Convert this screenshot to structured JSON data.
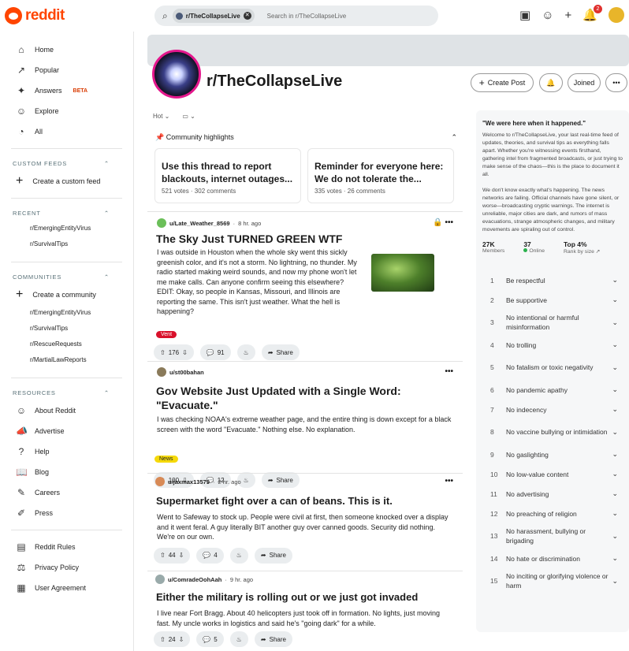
{
  "header": {
    "logo_text": "reddit",
    "search_chip": "r/TheCollapseLive",
    "search_placeholder": "Search in r/TheCollapseLive",
    "notif_count": "2"
  },
  "nav": {
    "main": [
      {
        "label": "Home",
        "icon": "home-icon",
        "glyph": "⌂"
      },
      {
        "label": "Popular",
        "icon": "popular-icon",
        "glyph": "↗"
      },
      {
        "label": "Answers",
        "icon": "answers-icon",
        "glyph": "✦",
        "badge": "BETA"
      },
      {
        "label": "Explore",
        "icon": "explore-icon",
        "glyph": "☺"
      },
      {
        "label": "All",
        "icon": "all-icon",
        "glyph": "◔"
      }
    ],
    "custom_feeds_title": "CUSTOM FEEDS",
    "create_custom_feed": "Create a custom feed",
    "recent_title": "RECENT",
    "recent": [
      "r/EmergingEntityVirus",
      "r/SurvivalTips"
    ],
    "communities_title": "COMMUNITIES",
    "create_community": "Create a community",
    "communities": [
      "r/EmergingEntityVirus",
      "r/SurvivalTips",
      "r/RescueRequests",
      "r/MartialLawReports"
    ],
    "resources_title": "RESOURCES",
    "resources": [
      {
        "label": "About Reddit",
        "glyph": "☺"
      },
      {
        "label": "Advertise",
        "glyph": "📣"
      },
      {
        "label": "Help",
        "glyph": "?"
      },
      {
        "label": "Blog",
        "glyph": "📖"
      },
      {
        "label": "Careers",
        "glyph": "✎"
      },
      {
        "label": "Press",
        "glyph": "✐"
      }
    ],
    "legal": [
      {
        "label": "Reddit Rules",
        "glyph": "▤"
      },
      {
        "label": "Privacy Policy",
        "glyph": "⚖"
      },
      {
        "label": "User Agreement",
        "glyph": "▦"
      }
    ]
  },
  "subreddit": {
    "name": "r/TheCollapseLive",
    "create_post": "Create Post",
    "joined": "Joined"
  },
  "feed": {
    "sort": "Hot",
    "highlights_title": "Community highlights",
    "highlights": [
      {
        "title": "Use this thread to report blackouts, internet outages...",
        "meta": "521 votes · 302 comments"
      },
      {
        "title": "Reminder for everyone here: We do not tolerate the...",
        "meta": "335 votes · 26 comments"
      }
    ],
    "posts": [
      {
        "user": "u/Late_Weather_8569",
        "time": "8 hr. ago",
        "title": "The Sky Just TURNED GREEN WTF",
        "body": "I was outside in Houston when the whole sky went this sickly greenish color, and it's not a storm. No lightning, no thunder. My radio started making weird sounds, and now my phone won't let me make calls. Can anyone confirm seeing this elsewhere?\nEDIT: Okay, so people in Kansas, Missouri, and Illinois are reporting the same. This isn't just weather. What the hell is happening?",
        "flair": "Vent",
        "votes": "176",
        "comments": "91",
        "share": "Share"
      },
      {
        "user": "u/st00bahan",
        "time": "",
        "title": "Gov Website Just Updated with a Single Word: \"Evacuate.\"",
        "body": "I was checking NOAA's extreme weather page, and the entire thing is down except for a black screen with the word \"Evacuate.\" Nothing else. No explanation.",
        "flair": "News",
        "votes": "100",
        "comments": "12",
        "share": "Share"
      },
      {
        "user": "u/jaxmax13579",
        "time": "2 hr. ago",
        "title": "Supermarket fight over a can of beans. This is it.",
        "body": "Went to Safeway to stock up. People were civil at first, then someone knocked over a display and it went feral. A guy literally BIT another guy over canned goods. Security did nothing. We're on our own.",
        "votes": "44",
        "comments": "4",
        "share": "Share"
      },
      {
        "user": "u/ComradeOohAah",
        "time": "9 hr. ago",
        "title": "Either the military is rolling out or we just got invaded",
        "body": "I live near Fort Bragg. About 40 helicopters just took off in formation. No lights, just moving fast. My uncle works in logistics and said he's \"going dark\" for a while.",
        "votes": "24",
        "comments": "5",
        "share": "Share"
      }
    ]
  },
  "sidebar": {
    "tagline": "\"We were here when it happened.\"",
    "desc1": "Welcome to r/TheCollapseLive, your last real-time feed of updates, theories, and survival tips as everything falls apart. Whether you're witnessing events firsthand, gathering intel from fragmented broadcasts, or just trying to make sense of the chaos—this is the place to document it all.",
    "desc2": "We don't know exactly what's happening. The news networks are failing. Official channels have gone silent, or worse—broadcasting cryptic warnings. The internet is unreliable, major cities are dark, and rumors of mass evacuations, strange atmospheric changes, and military movements are spiraling out of control.",
    "members": "27K",
    "members_label": "Members",
    "online": "37",
    "online_label": "Online",
    "rank": "Top 4%",
    "rank_label": "Rank by size",
    "rules": [
      "Be respectful",
      "Be supportive",
      "No intentional or harmful misinformation",
      "No trolling",
      "No fatalism or toxic negativity",
      "No pandemic apathy",
      "No indecency",
      "No vaccine bullying or intimidation",
      "No gaslighting",
      "No low-value content",
      "No advertising",
      "No preaching of religion",
      "No harassment, bullying or brigading",
      "No hate or discrimination",
      "No inciting or glorifying violence or harm"
    ]
  },
  "colors": {
    "brand": "#ff4500",
    "vent_flair": "#d9112b",
    "news_flair": "#f5d90a"
  }
}
